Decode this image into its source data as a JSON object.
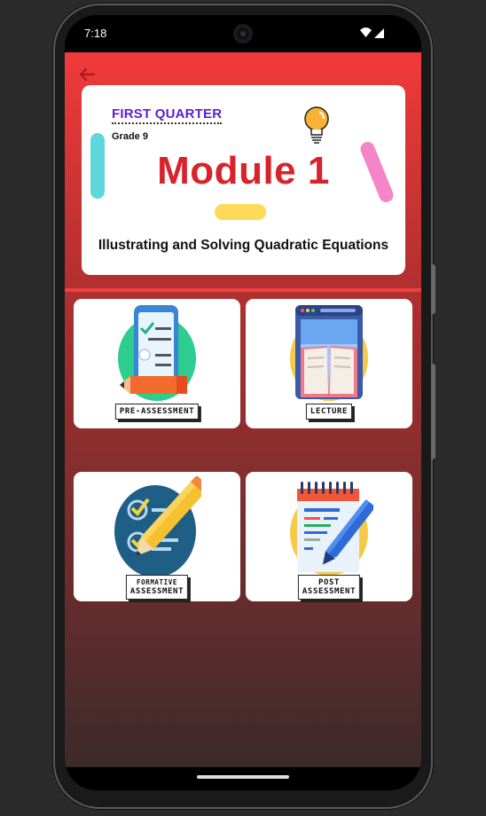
{
  "status_bar": {
    "time": "7:18"
  },
  "header": {
    "back_icon": "arrow-left-icon"
  },
  "module_card": {
    "quarter": "FIRST QUARTER",
    "grade": "Grade 9",
    "title": "Module 1",
    "subtitle": "Illustrating and Solving Quadratic Equations"
  },
  "tiles": [
    {
      "label": "PRE-ASSESSMENT",
      "icon": "checklist-phone-icon"
    },
    {
      "label": "LECTURE",
      "icon": "open-book-icon"
    },
    {
      "label_line1": "FORMATIVE",
      "label_line2": "ASSESSMENT",
      "icon": "checklist-pencil-icon"
    },
    {
      "label_line1": "POST",
      "label_line2": "ASSESSMENT",
      "icon": "notepad-pen-icon"
    }
  ],
  "colors": {
    "accent_red": "#f13a3a",
    "title_red": "#d9232b",
    "quarter_purple": "#5b1fd1"
  }
}
